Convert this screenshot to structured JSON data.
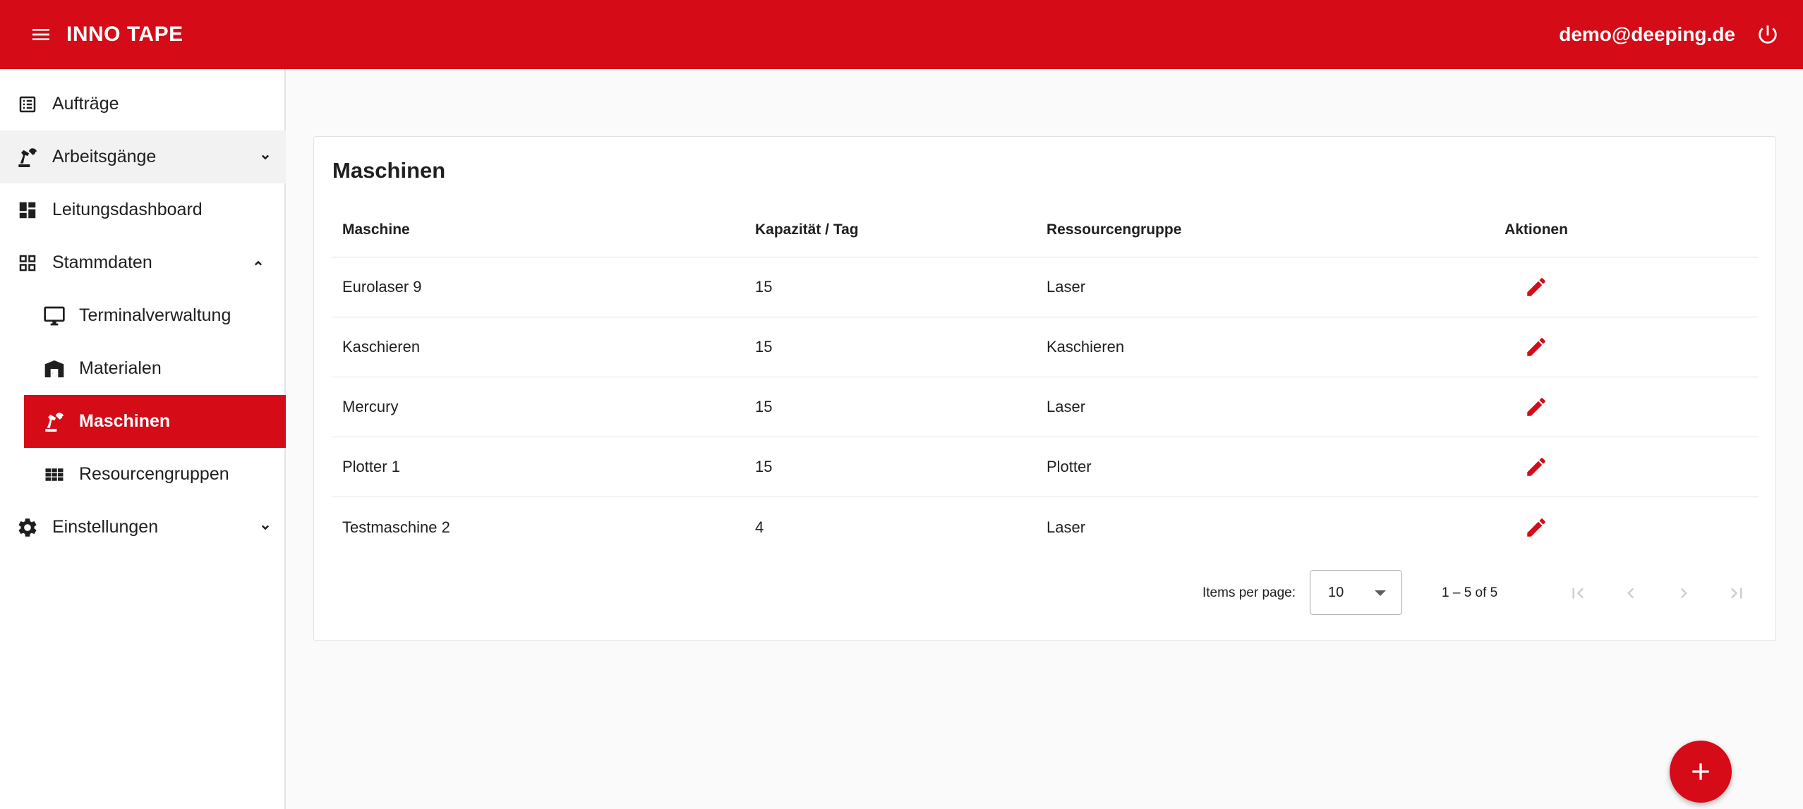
{
  "app": {
    "title": "INNO TAPE",
    "user_email": "demo@deeping.de",
    "colors": {
      "primary": "#d50b17",
      "primary_text": "#ffffff",
      "text": "#1f1f1f"
    }
  },
  "icons": {
    "menu": "menu-icon",
    "power": "power-icon",
    "edit": "pencil-icon",
    "add": "plus-icon"
  },
  "sidebar": {
    "items": [
      {
        "label": "Aufträge",
        "icon": "list-icon"
      },
      {
        "label": "Arbeitsgänge",
        "icon": "robot-arm-icon",
        "expandable": true,
        "expanded": false
      },
      {
        "label": "Leitungsdashboard",
        "icon": "dashboard-icon"
      },
      {
        "label": "Stammdaten",
        "icon": "grid-icon",
        "expandable": true,
        "expanded": true
      },
      {
        "label": "Terminalverwaltung",
        "icon": "monitor-icon"
      },
      {
        "label": "Materialen",
        "icon": "warehouse-icon"
      },
      {
        "label": "Maschinen",
        "icon": "robot-arm-icon",
        "active": true
      },
      {
        "label": "Resourcengruppen",
        "icon": "apps-icon"
      },
      {
        "label": "Einstellungen",
        "icon": "gear-icon",
        "expandable": true,
        "expanded": false
      }
    ]
  },
  "main": {
    "title": "Maschinen",
    "table": {
      "headers": [
        "Maschine",
        "Kapazität / Tag",
        "Ressourcengruppe",
        "Aktionen"
      ],
      "rows": [
        [
          "Eurolaser 9",
          "15",
          "Laser"
        ],
        [
          "Kaschieren",
          "15",
          "Kaschieren"
        ],
        [
          "Mercury",
          "15",
          "Laser"
        ],
        [
          "Plotter 1",
          "15",
          "Plotter"
        ],
        [
          "Testmaschine 2",
          "4",
          "Laser"
        ]
      ]
    },
    "paginator": {
      "items_per_page_label": "Items per page:",
      "page_size": "10",
      "range_label": "1 – 5 of 5"
    }
  }
}
